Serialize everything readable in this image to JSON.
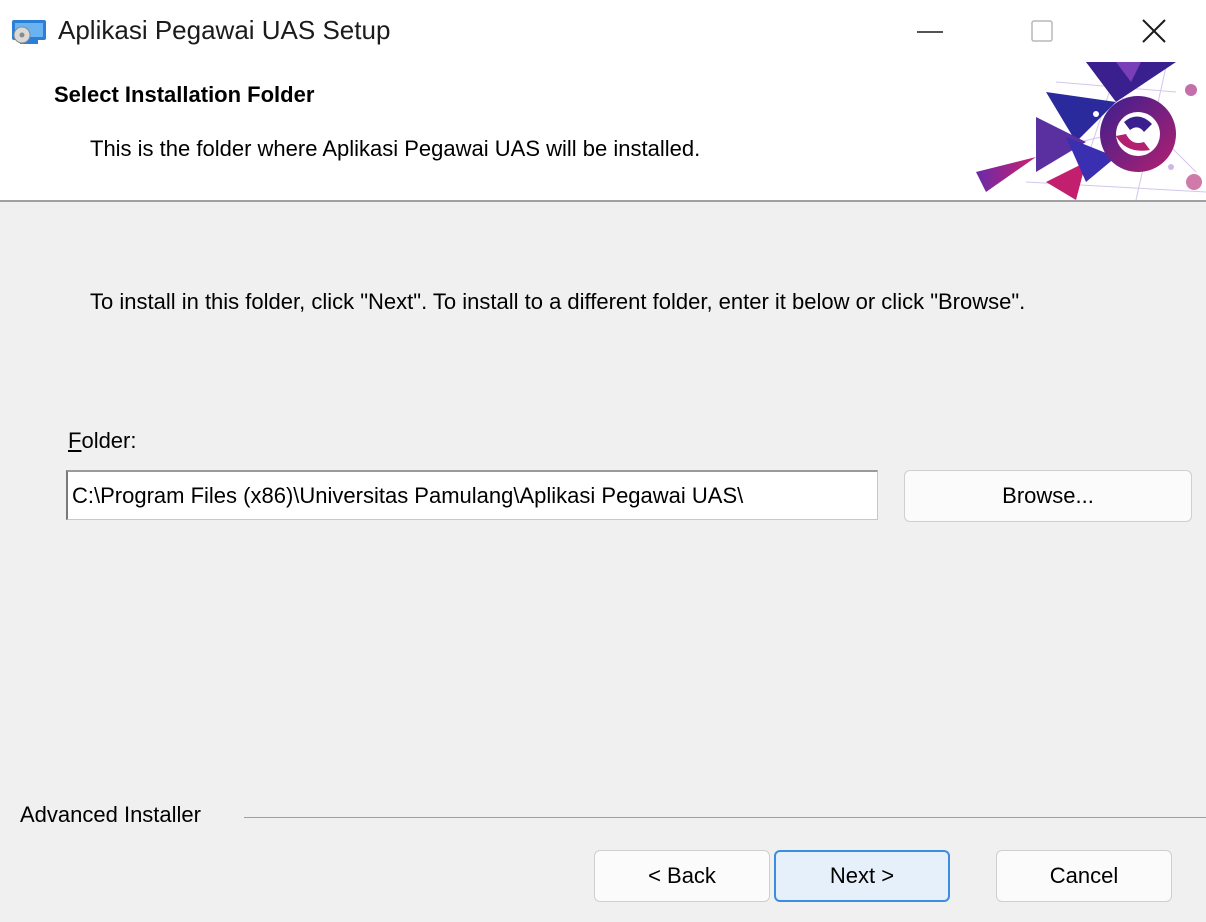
{
  "window": {
    "title": "Aplikasi Pegawai UAS Setup",
    "icons": {
      "app": "installer-app-icon",
      "minimize": "minimize-icon",
      "maximize": "maximize-icon",
      "close": "close-icon"
    }
  },
  "header": {
    "title": "Select Installation Folder",
    "subtitle": "This is the folder where Aplikasi Pegawai UAS will be installed.",
    "logo": "university-logo"
  },
  "body": {
    "instruction": "To install in this folder, click \"Next\". To install to a different folder, enter it below or click \"Browse\".",
    "folder_label_mnemonic": "F",
    "folder_label_rest": "older:",
    "folder_value": "C:\\Program Files (x86)\\Universitas Pamulang\\Aplikasi Pegawai UAS\\",
    "browse_label": "Browse..."
  },
  "footer": {
    "brand": "Advanced Installer",
    "back_label": "< Back",
    "next_label": "Next >",
    "cancel_label": "Cancel"
  },
  "colors": {
    "accent": "#3c8de0",
    "logo_purple": "#3a1f8f",
    "logo_magenta": "#b3206f"
  }
}
